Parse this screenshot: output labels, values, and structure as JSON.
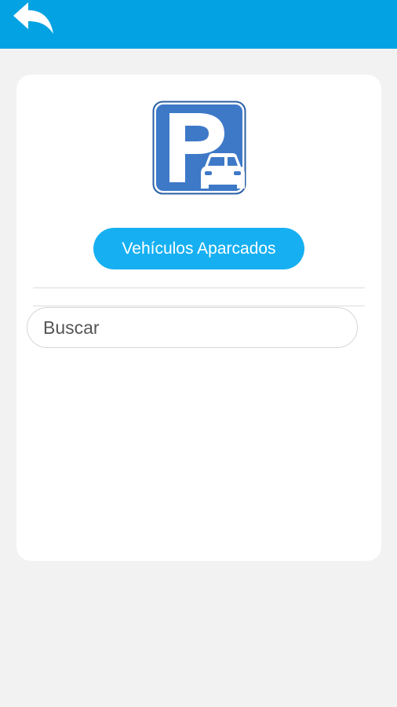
{
  "header": {
    "back_icon": "reply-arrow-icon",
    "background_color": "#03a3e3"
  },
  "card": {
    "logo_icon": "parking-car-icon",
    "primary_button_label": "Vehículos Aparcados",
    "primary_button_color": "#16b0f2",
    "search": {
      "placeholder": "Buscar",
      "value": ""
    }
  }
}
